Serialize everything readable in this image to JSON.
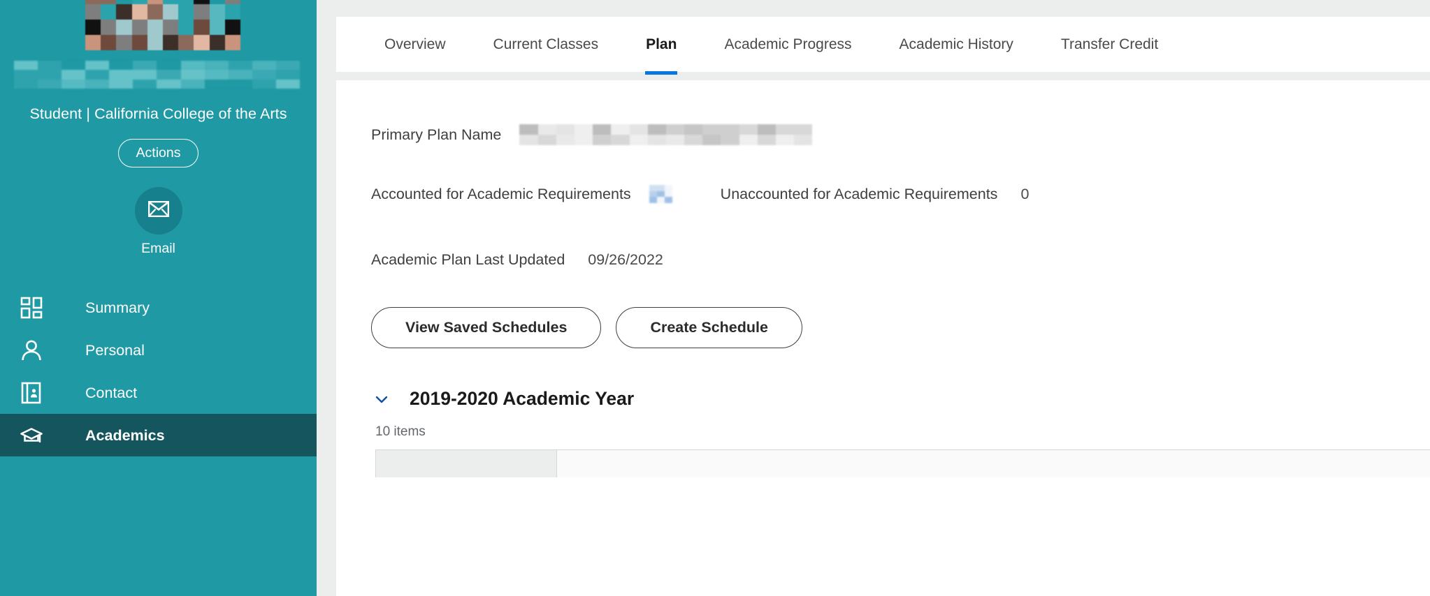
{
  "theme": {
    "sidebar_bg": "#1f99a4",
    "sidebar_active_bg": "#15565e",
    "tab_active_underline": "#0875e1",
    "content_bg": "#eceded",
    "panel_bg": "#ffffff"
  },
  "sidebar": {
    "profile_role": "Student | California College of the Arts",
    "actions_label": "Actions",
    "email_label": "Email",
    "email_icon": "envelope-icon",
    "avatar_redacted": true,
    "name_redacted": true,
    "nav_items": [
      {
        "label": "Summary",
        "icon": "grid-dashboard-icon",
        "active": false
      },
      {
        "label": "Personal",
        "icon": "person-icon",
        "active": false
      },
      {
        "label": "Contact",
        "icon": "address-book-icon",
        "active": false
      },
      {
        "label": "Academics",
        "icon": "graduation-cap-icon",
        "active": true
      }
    ]
  },
  "tabs": [
    {
      "label": "Overview",
      "active": false
    },
    {
      "label": "Current Classes",
      "active": false
    },
    {
      "label": "Plan",
      "active": true
    },
    {
      "label": "Academic Progress",
      "active": false
    },
    {
      "label": "Academic History",
      "active": false
    },
    {
      "label": "Transfer Credit",
      "active": false
    }
  ],
  "plan": {
    "primary_plan_name_label": "Primary Plan Name",
    "primary_plan_name_value": "",
    "accounted_label": "Accounted for Academic Requirements",
    "accounted_value": "",
    "unaccounted_label": "Unaccounted for Academic Requirements",
    "unaccounted_value": "0",
    "last_updated_label": "Academic Plan Last Updated",
    "last_updated_value": "09/26/2022",
    "view_saved_schedules_label": "View Saved Schedules",
    "create_schedule_label": "Create Schedule",
    "year_section": {
      "chevron_icon": "chevron-down-icon",
      "title": "2019-2020 Academic Year",
      "items_count": "10 items"
    }
  }
}
